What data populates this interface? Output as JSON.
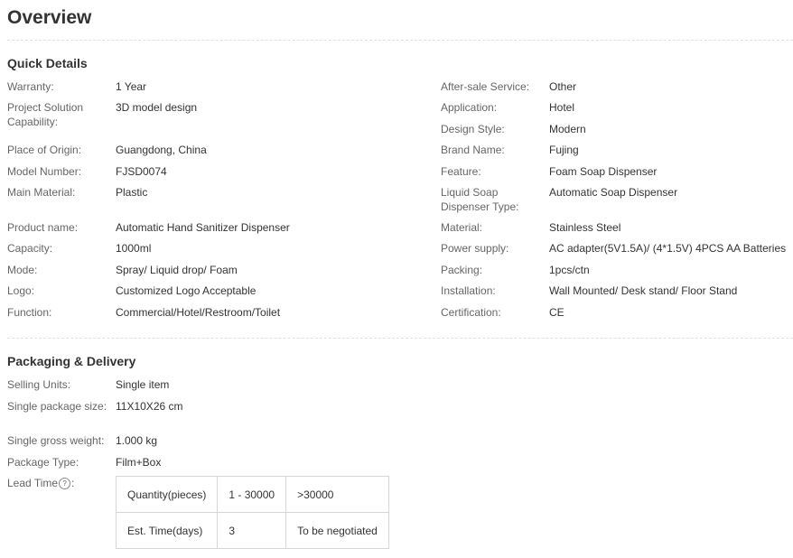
{
  "title": "Overview",
  "quick_details": {
    "heading": "Quick Details",
    "left": [
      {
        "label": "Warranty:",
        "value": "1 Year"
      },
      {
        "label": "Project Solution Capability:",
        "value": "3D model design"
      },
      {
        "label": "Place of Origin:",
        "value": "Guangdong, China"
      },
      {
        "label": "Model Number:",
        "value": "FJSD0074"
      },
      {
        "label": "Main Material:",
        "value": "Plastic"
      },
      {
        "label": "Product name:",
        "value": "Automatic Hand Sanitizer Dispenser"
      },
      {
        "label": "Capacity:",
        "value": "1000ml"
      },
      {
        "label": "Mode:",
        "value": "Spray/ Liquid drop/ Foam"
      },
      {
        "label": "Logo:",
        "value": "Customized Logo Acceptable"
      },
      {
        "label": "Function:",
        "value": "Commercial/Hotel/Restroom/Toilet"
      }
    ],
    "right": [
      {
        "label": "After-sale Service:",
        "value": "Other"
      },
      {
        "label": "Application:",
        "value": "Hotel"
      },
      {
        "label": "Design Style:",
        "value": "Modern"
      },
      {
        "label": "Brand Name:",
        "value": "Fujing"
      },
      {
        "label": "Feature:",
        "value": "Foam Soap Dispenser"
      },
      {
        "label": "Liquid Soap Dispenser Type:",
        "value": "Automatic Soap Dispenser"
      },
      {
        "label": "Material:",
        "value": "Stainless Steel"
      },
      {
        "label": "Power supply:",
        "value": "AC adapter(5V1.5A)/ (4*1.5V) 4PCS AA Batteries"
      },
      {
        "label": "Packing:",
        "value": "1pcs/ctn"
      },
      {
        "label": "Installation:",
        "value": "Wall Mounted/ Desk stand/ Floor Stand"
      },
      {
        "label": "Certification:",
        "value": "CE"
      }
    ]
  },
  "packaging": {
    "heading": "Packaging & Delivery",
    "rows": [
      {
        "label": "Selling Units:",
        "value": "Single item"
      },
      {
        "label": "Single package size:",
        "value": "11X10X26 cm"
      },
      {
        "label": "Single gross weight:",
        "value": "1.000 kg"
      },
      {
        "label": "Package Type:",
        "value": "Film+Box"
      }
    ],
    "lead_time_label": "Lead Time",
    "lead_time_icon": "question-circle-icon",
    "lead_table": [
      [
        "Quantity(pieces)",
        "1 - 30000",
        ">30000"
      ],
      [
        "Est. Time(days)",
        "3",
        "To be negotiated"
      ]
    ]
  }
}
